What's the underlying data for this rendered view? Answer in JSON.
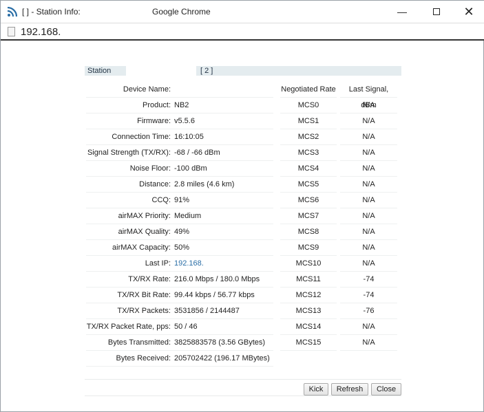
{
  "window": {
    "title": "[ ] - Station Info:",
    "app": "Google Chrome",
    "url": "192.168."
  },
  "header": {
    "tab": "Station",
    "id": "[ 2 ]"
  },
  "info": [
    {
      "k": "Device Name:",
      "v": ""
    },
    {
      "k": "Product:",
      "v": "NB2"
    },
    {
      "k": "Firmware:",
      "v": "v5.5.6"
    },
    {
      "k": "Connection Time:",
      "v": "16:10:05"
    },
    {
      "k": "Signal Strength (TX/RX):",
      "v": "-68 / -66 dBm"
    },
    {
      "k": "Noise Floor:",
      "v": "-100 dBm"
    },
    {
      "k": "Distance:",
      "v": "2.8 miles (4.6 km)"
    },
    {
      "k": "CCQ:",
      "v": "91%"
    },
    {
      "k": "airMAX Priority:",
      "v": "Medium"
    },
    {
      "k": "airMAX Quality:",
      "v": "49%"
    },
    {
      "k": "airMAX Capacity:",
      "v": "50%"
    },
    {
      "k": "Last IP:",
      "v": "192.168."
    },
    {
      "k": "TX/RX Rate:",
      "v": "216.0 Mbps / 180.0 Mbps"
    },
    {
      "k": "TX/RX Bit Rate:",
      "v": "99.44 kbps / 56.77 kbps"
    },
    {
      "k": "TX/RX Packets:",
      "v": "3531856 / 2144487"
    },
    {
      "k": "TX/RX Packet Rate, pps:",
      "v": "50 / 46"
    },
    {
      "k": "Bytes Transmitted:",
      "v": "3825883578 (3.56 GBytes)"
    },
    {
      "k": "Bytes Received:",
      "v": "205702422 (196.17 MBytes)"
    }
  ],
  "rates": {
    "headers": [
      "Negotiated Rate",
      "Last Signal, dBm"
    ],
    "rows": [
      [
        "MCS0",
        "N/A"
      ],
      [
        "MCS1",
        "N/A"
      ],
      [
        "MCS2",
        "N/A"
      ],
      [
        "MCS3",
        "N/A"
      ],
      [
        "MCS4",
        "N/A"
      ],
      [
        "MCS5",
        "N/A"
      ],
      [
        "MCS6",
        "N/A"
      ],
      [
        "MCS7",
        "N/A"
      ],
      [
        "MCS8",
        "N/A"
      ],
      [
        "MCS9",
        "N/A"
      ],
      [
        "MCS10",
        "N/A"
      ],
      [
        "MCS11",
        "-74"
      ],
      [
        "MCS12",
        "-74"
      ],
      [
        "MCS13",
        "-76"
      ],
      [
        "MCS14",
        "N/A"
      ],
      [
        "MCS15",
        "N/A"
      ]
    ]
  },
  "buttons": {
    "kick": "Kick",
    "refresh": "Refresh",
    "close": "Close"
  }
}
